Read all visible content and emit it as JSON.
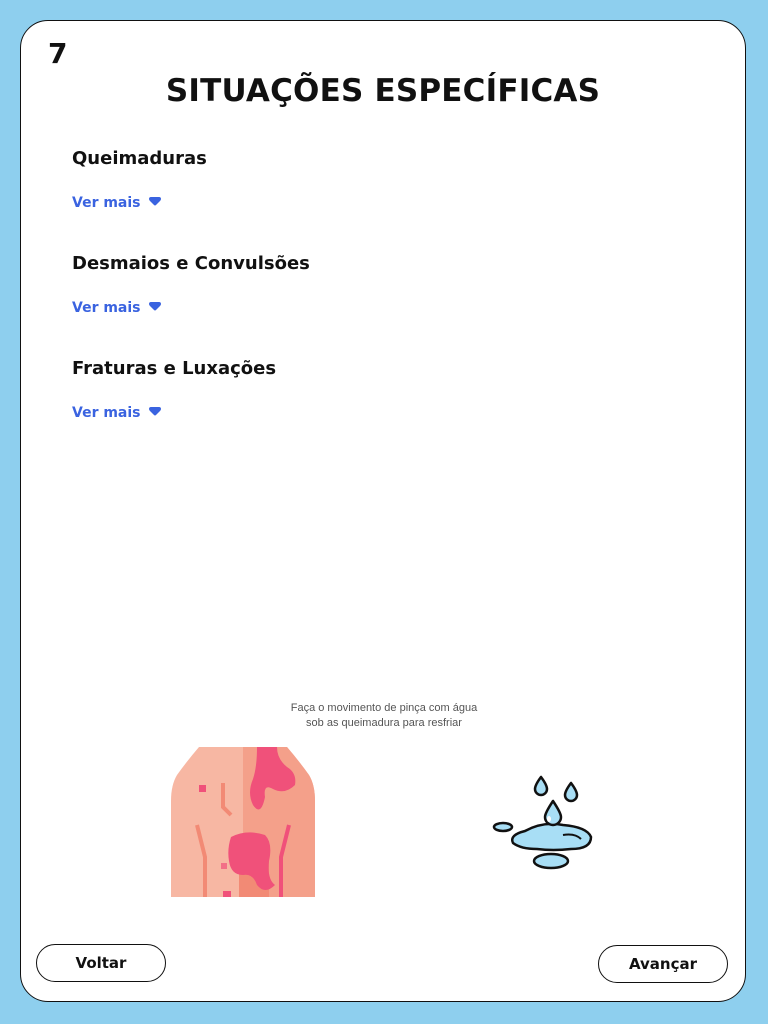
{
  "page": {
    "number": "7",
    "title": "SITUAÇÕES ESPECÍFICAS"
  },
  "sections": [
    {
      "title": "Queimaduras",
      "toggle_label": "Ver mais"
    },
    {
      "title": "Desmaios e Convulsões",
      "toggle_label": "Ver mais"
    },
    {
      "title": "Fraturas e Luxações",
      "toggle_label": "Ver mais"
    }
  ],
  "hint": {
    "line1": "Faça o movimento de pinça com água",
    "line2": "sob as queimadura para resfriar"
  },
  "icons": {
    "expand": "caret-down-icon",
    "illustration_left": "burned-torso-icon",
    "illustration_right": "water-drops-icon"
  },
  "colors": {
    "background": "#8ecfee",
    "accent": "#3a63e0"
  },
  "footer": {
    "back_label": "Voltar",
    "next_label": "Avançar"
  }
}
